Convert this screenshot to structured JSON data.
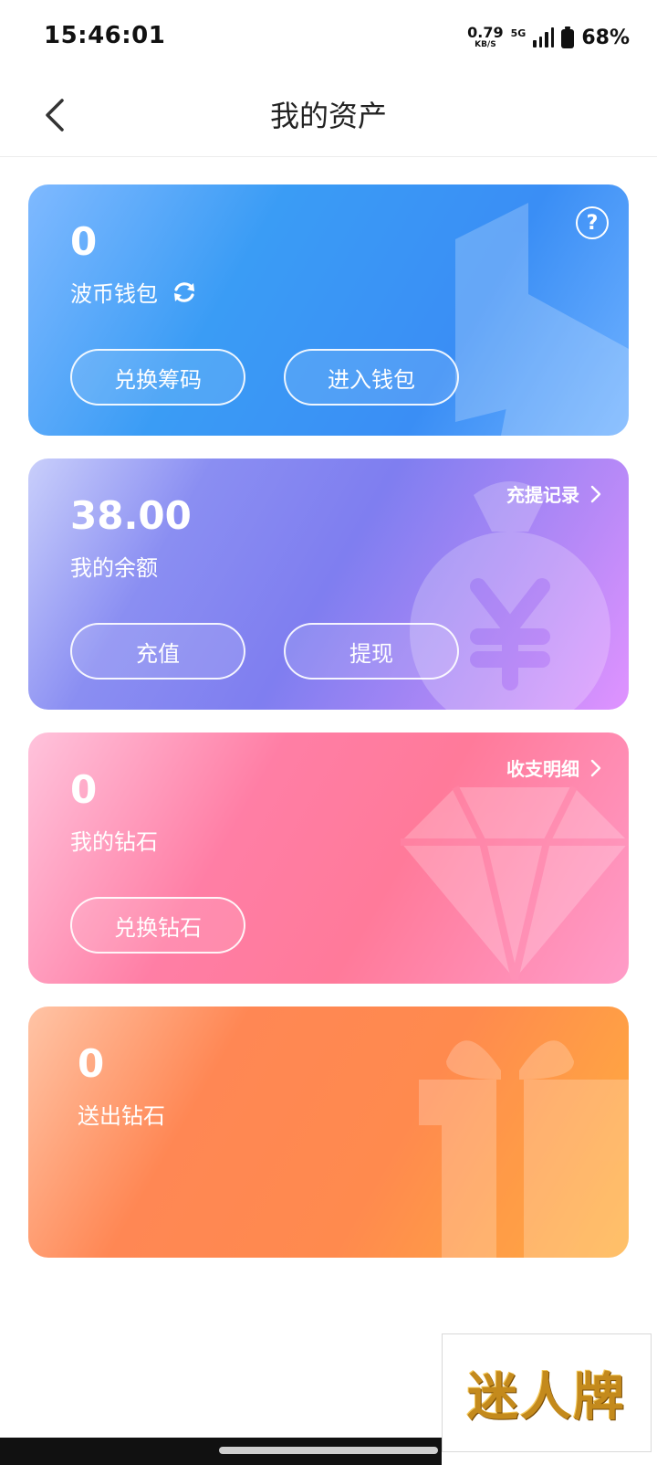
{
  "status_bar": {
    "time": "15:46:01",
    "net_speed_value": "0.79",
    "net_speed_unit": "KB/S",
    "network_type": "5G",
    "battery": "68%"
  },
  "nav": {
    "title": "我的资产",
    "back_icon": "chevron-left-icon"
  },
  "wallet_card": {
    "amount": "0",
    "label": "波币钱包",
    "refresh_icon": "refresh-icon",
    "help_icon": "question-icon",
    "help_symbol": "?",
    "buttons": [
      "兑换筹码",
      "进入钱包"
    ]
  },
  "balance_card": {
    "amount": "38.00",
    "label": "我的余额",
    "link": "充提记录",
    "buttons": [
      "充值",
      "提现"
    ]
  },
  "diamond_card": {
    "amount": "0",
    "label": "我的钻石",
    "link": "收支明细",
    "buttons": [
      "兑换钻石"
    ]
  },
  "sent_card": {
    "amount": "0",
    "label": "送出钻石"
  },
  "watermark": {
    "text": "迷人牌"
  },
  "colors": {
    "wallet": "#3a9cf5",
    "balance": "#7f7ef0",
    "diamond": "#ff7a9a",
    "sent": "#ff8a4e"
  }
}
